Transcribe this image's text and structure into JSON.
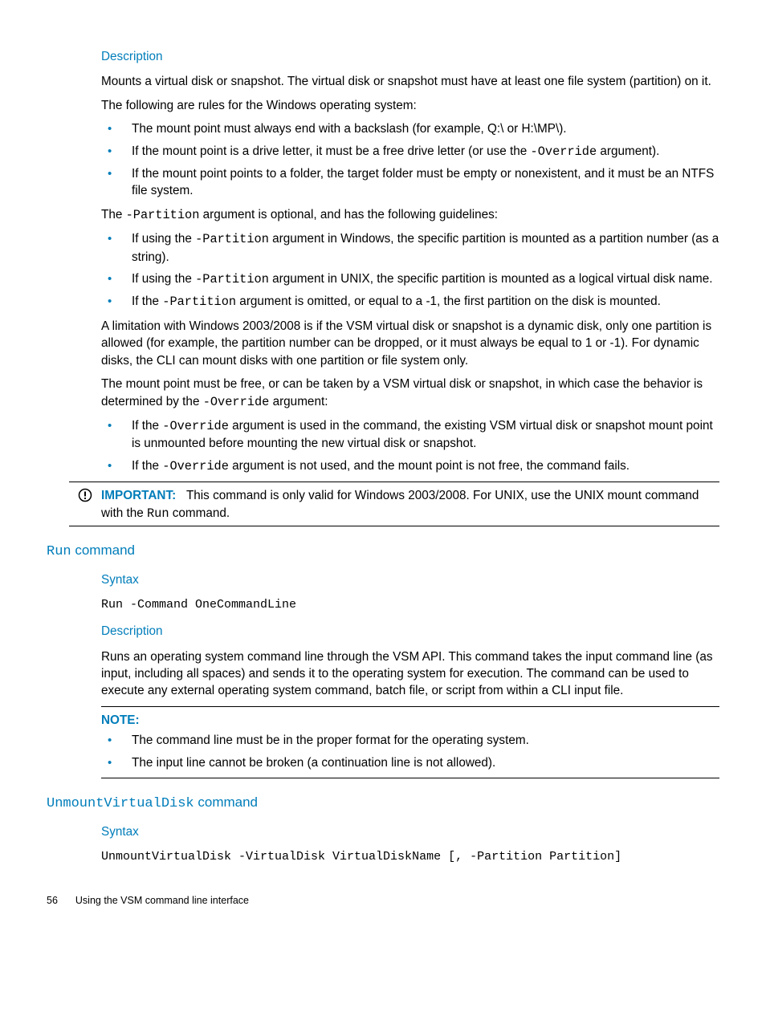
{
  "sec1": {
    "desc_h": "Description",
    "desc_p1": "Mounts a virtual disk or snapshot. The virtual disk or snapshot must have at least one file system (partition) on it.",
    "desc_p2": "The following are rules for the Windows operating system:",
    "rules": [
      {
        "text": "The mount point must always end with a backslash (for example, Q:\\ or H:\\MP\\)."
      },
      {
        "pre": "If the mount point is a drive letter, it must be a free drive letter (or use the ",
        "code": "-Override",
        "post": " argument)."
      },
      {
        "text": "If the mount point points to a folder, the target folder must be empty or nonexistent, and it must be an NTFS file system."
      }
    ],
    "part_p_pre": "The ",
    "part_p_code": "-Partition",
    "part_p_post": " argument is optional, and has the following guidelines:",
    "part_rules": [
      {
        "pre": "If using the ",
        "code": "-Partition",
        "post": " argument in Windows, the specific partition is mounted as a partition number (as a string)."
      },
      {
        "pre": "If using the ",
        "code": "-Partition",
        "post": " argument in UNIX, the specific partition is mounted as a logical virtual disk name."
      },
      {
        "pre": "If the ",
        "code": "-Partition",
        "post": " argument is omitted, or equal to a -1, the first partition on the disk is mounted."
      }
    ],
    "limit_p": "A limitation with Windows 2003/2008 is if the VSM virtual disk or snapshot is a dynamic disk, only one partition is allowed (for example, the partition number can be dropped, or it must always be equal to 1 or -1). For dynamic disks, the CLI can mount disks with one partition or file system only.",
    "mp_p_pre": "The mount point must be free, or can be taken by a VSM virtual disk or snapshot, in which case the behavior is determined by the ",
    "mp_p_code": "-Override",
    "mp_p_post": " argument:",
    "ov_rules": [
      {
        "pre": "If the ",
        "code": "-Override",
        "post": " argument is used in the command, the existing VSM virtual disk or snapshot mount point is unmounted before mounting the new virtual disk or snapshot."
      },
      {
        "pre": "If the ",
        "code": "-Override",
        "post": " argument is not used, and the mount point is not free, the command fails."
      }
    ]
  },
  "important": {
    "label": "IMPORTANT:",
    "pre": "This command is only valid for Windows 2003/2008. For UNIX, use the UNIX mount command with the ",
    "code": "Run",
    "post": " command."
  },
  "run": {
    "h_code": "Run",
    "h_text": " command",
    "syntax_h": "Syntax",
    "syntax": "Run -Command OneCommandLine",
    "desc_h": "Description",
    "desc": "Runs an operating system command line through the VSM API. This command takes the input command line (as input, including all spaces) and sends it to the operating system for execution. The command can be used to execute any external operating system command, batch file, or script from within a CLI input file.",
    "note_label": "NOTE:",
    "notes": [
      "The command line must be in the proper format for the operating system.",
      "The input line cannot be broken (a continuation line is not allowed)."
    ]
  },
  "unmount": {
    "h_code": "UnmountVirtualDisk",
    "h_text": " command",
    "syntax_h": "Syntax",
    "syntax": "UnmountVirtualDisk -VirtualDisk VirtualDiskName [, -Partition Partition]"
  },
  "footer": {
    "page": "56",
    "title": "Using the VSM command line interface"
  }
}
